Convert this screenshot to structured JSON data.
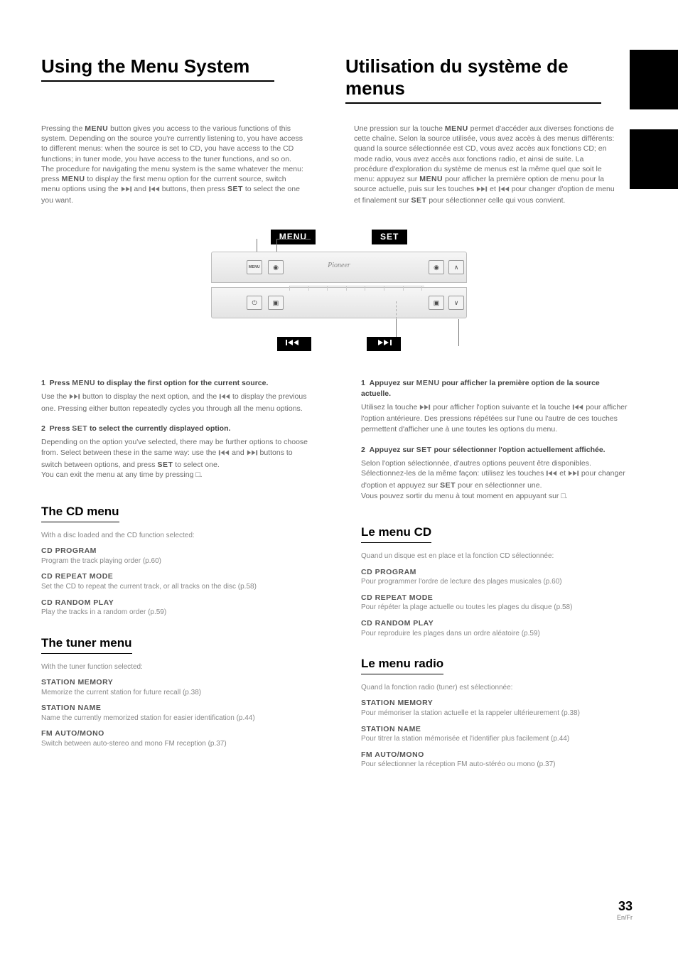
{
  "titles": {
    "en": "Using the Menu System",
    "fr": "Utilisation du système de menus"
  },
  "intro": {
    "en": "Pressing the MENU button gives you access to the various functions of this system. Depending on the source you're currently listening to, you have access to different menus: when the source is set to CD, you have access to the CD functions; in tuner mode, you have access to the tuner functions, and so on. The procedure for navigating the menu system is the same whatever the menu: press MENU to display the first menu option for the current source, switch menu options using the ¢ and 4 buttons, then press SET to select the one you want.",
    "fr": "Une pression sur la touche MENU permet d'accéder aux diverses fonctions de cette chaîne. Selon la source utilisée, vous avez accès à des menus différents: quand la source sélectionnée est CD, vous avez accès aux fonctions CD; en mode radio, vous avez accès aux fonctions radio, et ainsi de suite. La procédure d'exploration du système de menus est la même quel que soit le menu: appuyez sur MENU pour afficher la première option de menu pour la source actuelle, puis sur les touches ¢ et 4 pour changer d'option de menu et finalement sur SET pour sélectionner celle qui vous convient."
  },
  "device_labels": {
    "menu": "MENU",
    "set": "SET",
    "prev": "prev",
    "next": "next",
    "brand": "Pioneer",
    "btn_menu": "MENU"
  },
  "nav_icons": {
    "prev": "|◄◄",
    "next": "►►|"
  },
  "glyphs": {
    "stop": "■",
    "up": "∧",
    "down": "∨",
    "dot": "◉",
    "sq": "▣",
    "power": "⏻"
  },
  "en": {
    "step1": {
      "lead": "1 Press MENU to display the first option for the current source.",
      "body": "Use the ¢ button to display the next option, and the 4 to display the previous one. Pressing either button repeatedly cycles you through all the menu options."
    },
    "step2": {
      "lead": "2 Press SET to select the currently displayed option.",
      "body": "Depending on the option you've selected, there may be further options to choose from. Select between these in the same way: use the 4 and ¢ buttons to switch between options, and press SET to select one. You can exit the menu at any time by pressing 7."
    },
    "cd_h": "The CD menu",
    "cd_intro": "With a disc loaded and the CD function selected:",
    "cd_items": [
      {
        "k": "CD PROGRAM",
        "v": "Program the track playing order (p.60)"
      },
      {
        "k": "CD REPEAT MODE",
        "v": "Set the CD to repeat the current track, or all tracks on the disc (p.58)"
      },
      {
        "k": "CD RANDOM PLAY",
        "v": "Play the tracks in a random order (p.59)"
      }
    ],
    "tuner_h": "The tuner menu",
    "tuner_intro": "With the tuner function selected:",
    "tuner_items": [
      {
        "k": "STATION MEMORY",
        "v": "Memorize the current station for future recall (p.38)"
      },
      {
        "k": "STATION NAME",
        "v": "Name the currently memorized station for easier identification (p.44)"
      },
      {
        "k": "FM AUTO/MONO",
        "v": "Switch between auto-stereo and mono FM reception (p.37)"
      }
    ]
  },
  "fr": {
    "step1": {
      "lead": "1 Appuyez sur MENU pour afficher la première option de la source actuelle.",
      "body": "Utilisez la touche ¢ pour afficher l'option suivante et la touche 4 pour afficher l'option antérieure. Des pressions répétées sur l'une ou l'autre de ces touches permettent d'afficher une à une toutes les options du menu."
    },
    "step2": {
      "lead": "2 Appuyez sur SET pour sélectionner l'option actuellement affichée.",
      "body": "Selon l'option sélectionnée, d'autres options peuvent être disponibles. Sélectionnez-les de la même façon: utilisez les touches 4 et ¢ pour changer d'option et appuyez sur SET pour en sélectionner une. Vous pouvez sortir du menu à tout moment en appuyant sur 7."
    },
    "cd_h": "Le menu CD",
    "cd_intro": "Quand un disque est en place et la fonction CD sélectionnée:",
    "cd_items": [
      {
        "k": "CD PROGRAM",
        "v": "Pour programmer l'ordre de lecture des plages musicales (p.60)"
      },
      {
        "k": "CD REPEAT MODE",
        "v": "Pour répéter la plage actuelle ou toutes les plages du disque (p.58)"
      },
      {
        "k": "CD RANDOM PLAY",
        "v": "Pour reproduire les plages dans un ordre aléatoire (p.59)"
      }
    ],
    "tuner_h": "Le menu radio",
    "tuner_intro": "Quand la fonction radio (tuner) est sélectionnée:",
    "tuner_items": [
      {
        "k": "STATION MEMORY",
        "v": "Pour mémoriser la station actuelle et la rappeler ultérieurement (p.38)"
      },
      {
        "k": "STATION NAME",
        "v": "Pour titrer la station mémorisée et l'identifier plus facilement (p.44)"
      },
      {
        "k": "FM AUTO/MONO",
        "v": "Pour sélectionner la réception FM auto-stéréo ou mono (p.37)"
      }
    ]
  },
  "page": {
    "num": "33",
    "lang": "En/Fr"
  }
}
